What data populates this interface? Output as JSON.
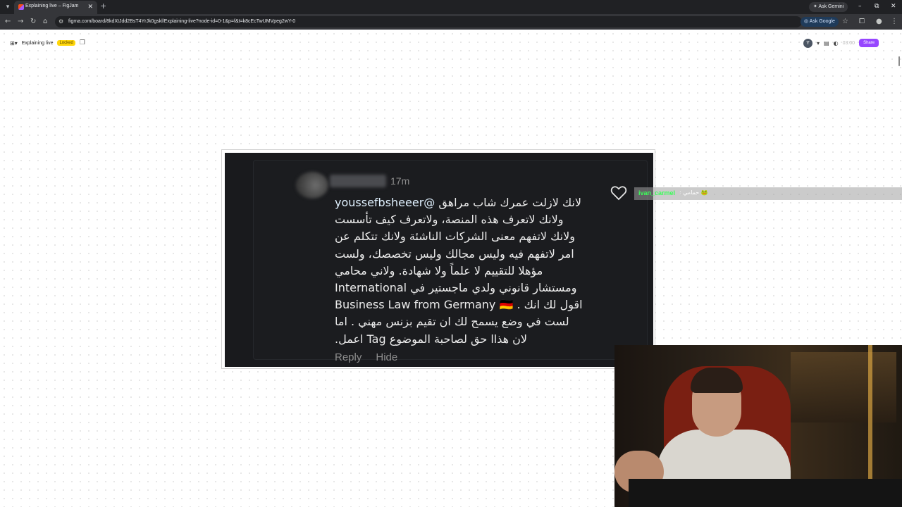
{
  "browser": {
    "tab_title": "Explaining live – FigJam",
    "new_tab": "+",
    "ask_gemini": "Ask Gemini",
    "url": "figma.com/board/8kdXtJdd2BsT4YrJk0gskl/Explaining-live?node-id=0-1&p=f&t=k8cEcTwUMVpeg2wY-0",
    "ask_google": "Ask Google"
  },
  "figjam": {
    "file_title": "Explaining live",
    "badge": "Locked",
    "avatar_initial": "Y",
    "timer": "03:00",
    "share_label": "Share"
  },
  "comment": {
    "time": "17m",
    "mention": "@youssefbsheeer",
    "line1": "لانك لازلت عمرك شاب مراهق",
    "line2": "ولانك لاتعرف هذه المنصة، ولاتعرف كيف تأسست",
    "line3": "ولانك لاتفهم معنى الشركات الناشئة ولانك تتكلم عن",
    "line4": "امر لاتفهم فيه وليس مجالك وليس تخصصك، ولست",
    "line5": "مؤهلا للتقييم لا علماً ولا شهادة.  ولاني محامي",
    "line6": "ومستشار قانوني ولدي ماجستير في International",
    "line7": "Business Law from Germany 🇩🇪 . اقول لك انك",
    "line8": "لست في وضع يسمح لك ان تقيم بزنس مهني . اما",
    "line9": "لان هذاا حق لصاحبة الموضوع Tag اعمل.",
    "reply": "Reply",
    "hide": "Hide"
  },
  "chat": {
    "username": "ivan_carmel",
    "message": ": حمامي 🐸"
  },
  "icons": {
    "heart": "heart-icon",
    "select": "cursor-icon",
    "hand": "hand-icon"
  }
}
